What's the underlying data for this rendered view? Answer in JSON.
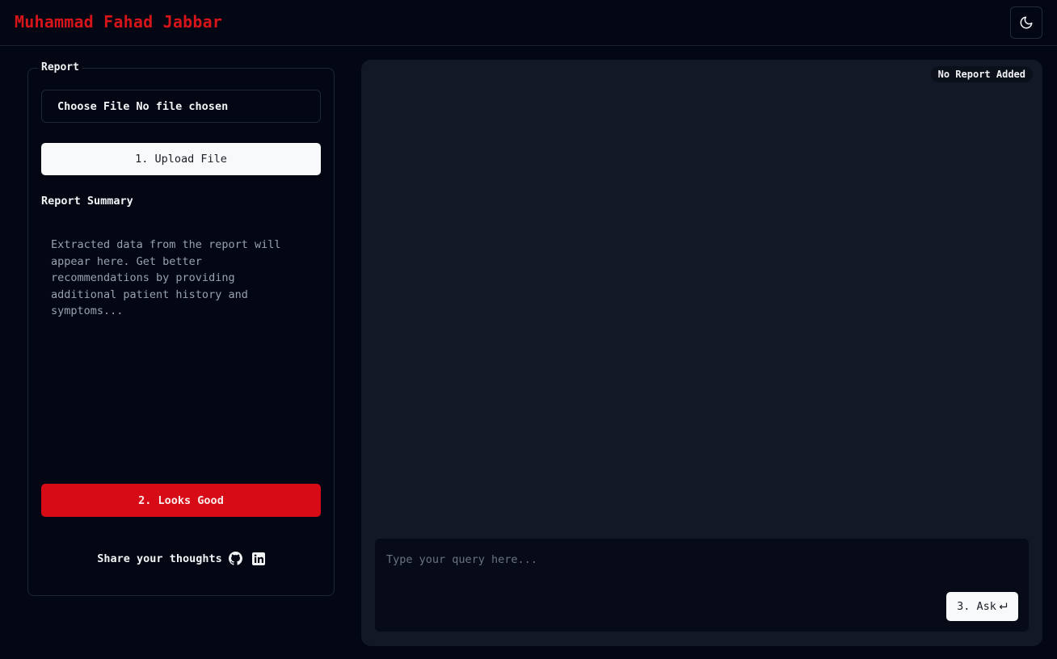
{
  "header": {
    "brand": "Muhammad Fahad Jabbar",
    "theme_toggle_icon": "moon-icon",
    "brand_color": "#d7141a"
  },
  "report_panel": {
    "legend": "Report",
    "file_input": {
      "button_label": "Choose File",
      "status": "No file chosen"
    },
    "upload_button": "1. Upload File",
    "summary_title": "Report Summary",
    "summary_placeholder": "Extracted data from the report will\nappear here. Get better\nrecommendations by providing\nadditional patient history and\nsymptoms...",
    "looks_good_button": "2. Looks Good",
    "share_text": "Share your thoughts",
    "share_icons": [
      "github-icon",
      "linkedin-icon"
    ],
    "accent_color": "#d70b16"
  },
  "chat_panel": {
    "badge": "No Report Added",
    "query_placeholder": "Type your query here...",
    "ask_button": "3. Ask",
    "ask_icon": "enter-icon"
  }
}
